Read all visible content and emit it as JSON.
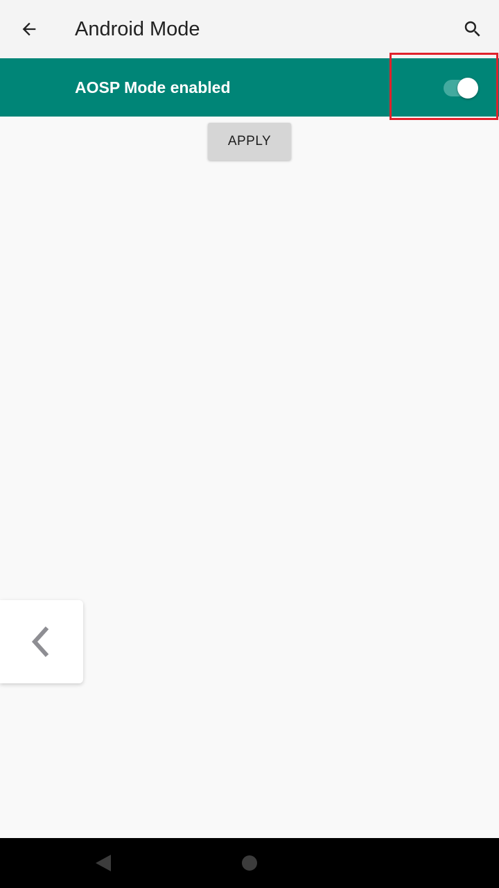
{
  "appbar": {
    "title": "Android Mode",
    "back_icon": "arrow-back-icon",
    "search_icon": "search-icon"
  },
  "master_switch": {
    "label": "AOSP Mode enabled",
    "checked": true
  },
  "actions": {
    "apply_label": "APPLY"
  },
  "side_handle": {
    "icon": "chevron-left-icon"
  },
  "navbar": {
    "back_icon": "nav-back-icon",
    "home_icon": "nav-home-icon"
  },
  "colors": {
    "accent": "#008577",
    "highlight": "#e0222b",
    "appbar_bg": "#f4f4f4",
    "page_bg": "#f9f9f9"
  }
}
